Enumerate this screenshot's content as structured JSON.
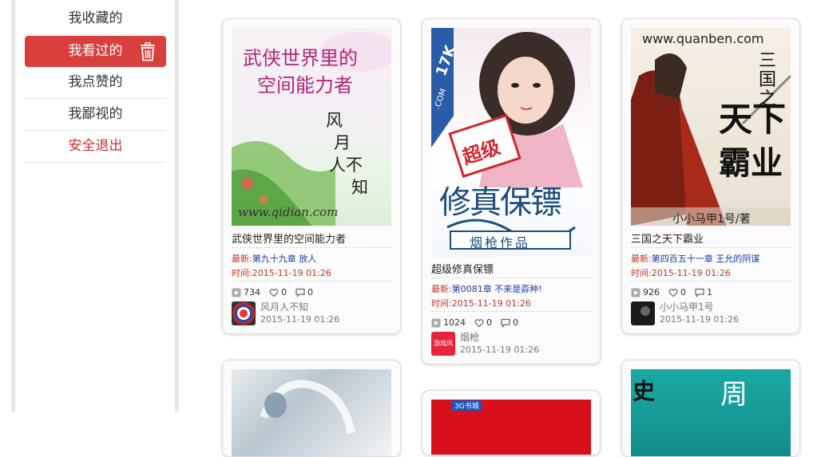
{
  "sidebar": {
    "items": [
      {
        "label": "我收藏的"
      },
      {
        "label": "我看过的"
      },
      {
        "label": "我点赞的"
      },
      {
        "label": "我鄙视的"
      },
      {
        "label": "安全退出"
      }
    ]
  },
  "labels": {
    "latest": "最新:",
    "time": "时间:"
  },
  "books": [
    {
      "title": "武侠世界里的空间能力者",
      "cover_text": [
        "武侠世界里的",
        "空间能力者",
        "风",
        "月",
        "人不",
        "知",
        "www.qidian.com"
      ],
      "chapter": "第九十九章 放人",
      "time": "2015-11-19 01:26",
      "views": "734",
      "likes": "0",
      "dislikes": "0",
      "author": "风月人不知",
      "author_time": "2015-11-19 01:26"
    },
    {
      "title": "超级修真保镖",
      "cover_text": [
        "17K",
        ".COM",
        "超级",
        "修真保镖",
        "烟枪作品"
      ],
      "chapter": "第0081章 不来是孬种!",
      "time": "2015-11-19 01:26",
      "views": "1024",
      "likes": "0",
      "dislikes": "0",
      "author": "烟枪",
      "author_time": "2015-11-19 01:26",
      "avatar_text": "游戏风"
    },
    {
      "title": "三国之天下霸业",
      "cover_text": [
        "www.quanben.com",
        "三国之",
        "天下",
        "霸业",
        "小小马甲1号/著"
      ],
      "chapter": "第四百五十一章 王允的阴谋",
      "time": "2015-11-19 01:26",
      "views": "926",
      "likes": "0",
      "dislikes": "1",
      "author": "小小马甲1号",
      "author_time": "2015-11-19 01:26"
    }
  ],
  "partial_covers": {
    "second_row_middle": "3G书城",
    "second_row_right": [
      "史",
      "周"
    ]
  },
  "colors": {
    "accent": "#d9403d",
    "chapter_link": "#1a3fa8",
    "label_red": "#c0392b"
  }
}
